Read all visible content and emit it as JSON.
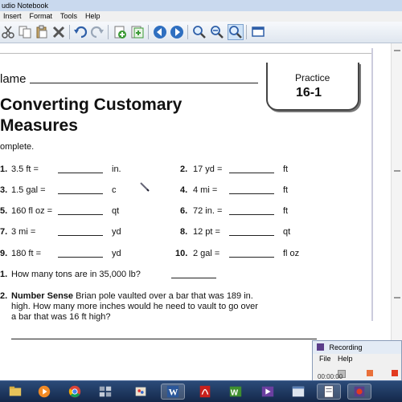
{
  "window": {
    "title": "udio Notebook"
  },
  "menu": [
    {
      "label": "Insert"
    },
    {
      "label": "Format"
    },
    {
      "label": "Tools"
    },
    {
      "label": "Help"
    }
  ],
  "toolbar_icons": [
    "cut-icon",
    "copy-icon",
    "paste-icon",
    "delete-icon",
    "undo-icon",
    "redo-icon",
    "add-page-icon",
    "insert-page-icon",
    "back-icon",
    "forward-icon",
    "zoom-in-icon",
    "zoom-out-icon",
    "zoom-fit-icon",
    "screen-icon"
  ],
  "worksheet": {
    "name_label": "lame",
    "practice_word": "Practice",
    "practice_number": "16-1",
    "title_line1": "Converting Customary",
    "title_line2": "Measures",
    "instruction": "omplete.",
    "problems_left": [
      {
        "num": "1.",
        "expr": "3.5 ft =",
        "unit": "in."
      },
      {
        "num": "3.",
        "expr": "1.5 gal =",
        "unit": "c"
      },
      {
        "num": "5.",
        "expr": "160 fl oz =",
        "unit": "qt"
      },
      {
        "num": "7.",
        "expr": "3 mi =",
        "unit": "yd"
      },
      {
        "num": "9.",
        "expr": "180 ft =",
        "unit": "yd"
      }
    ],
    "problems_right": [
      {
        "num": "2.",
        "expr": "17 yd =",
        "unit": "ft"
      },
      {
        "num": "4.",
        "expr": "4 mi =",
        "unit": "ft"
      },
      {
        "num": "6.",
        "expr": "72 in. =",
        "unit": "ft"
      },
      {
        "num": "8.",
        "expr": "12 pt =",
        "unit": "qt"
      },
      {
        "num": "10.",
        "expr": "2 gal =",
        "unit": "fl oz"
      }
    ],
    "q11_num": "1.",
    "q11_text": "How many tons are in 35,000 lb?",
    "q12_num": "2.",
    "q12_bold": "Number Sense",
    "q12_line1": "Brian pole vaulted over a bar that was 189 in.",
    "q12_line2": "high. How many more inches would he need to vault to go over",
    "q12_line3": "a bar that was 16 ft high?"
  },
  "recording": {
    "title": "Recording",
    "menu_file": "File",
    "menu_help": "Help",
    "time": "00:00:00"
  },
  "colors": {
    "taskbar": "#1c355f",
    "toolbar": "#e8edf4",
    "record_red": "#e23a1f"
  }
}
